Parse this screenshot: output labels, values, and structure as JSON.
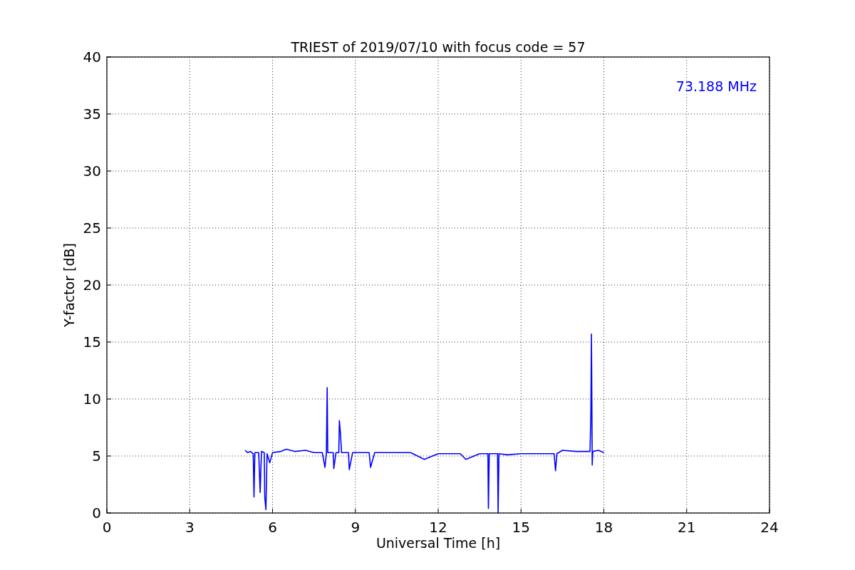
{
  "figure": {
    "chart_data": {
      "type": "line",
      "title": "TRIEST of 2019/07/10 with focus code = 57",
      "xlabel": "Universal Time [h]",
      "ylabel": "Y-factor [dB]",
      "xlim": [
        0,
        24
      ],
      "ylim": [
        0,
        40
      ],
      "xticks": [
        0,
        3,
        6,
        9,
        12,
        15,
        18,
        21,
        24
      ],
      "yticks": [
        0,
        5,
        10,
        15,
        20,
        25,
        30,
        35,
        40
      ],
      "x": [
        5.0,
        5.1,
        5.2,
        5.3,
        5.33,
        5.36,
        5.5,
        5.55,
        5.6,
        5.7,
        5.72,
        5.76,
        5.8,
        5.9,
        6.0,
        6.3,
        6.5,
        6.8,
        7.2,
        7.5,
        7.8,
        7.9,
        7.95,
        7.98,
        8.0,
        8.2,
        8.22,
        8.3,
        8.4,
        8.42,
        8.46,
        8.5,
        8.75,
        8.78,
        8.9,
        9.5,
        9.55,
        9.7,
        10.0,
        11.0,
        11.5,
        12.0,
        12.8,
        13.0,
        13.5,
        13.8,
        13.82,
        13.85,
        14.15,
        14.17,
        14.2,
        14.5,
        15.0,
        15.5,
        16.0,
        16.2,
        16.25,
        16.3,
        16.5,
        17.0,
        17.5,
        17.53,
        17.55,
        17.58,
        17.6,
        17.8,
        18.0
      ],
      "grid": true,
      "series": [
        {
          "color": "#0000ff",
          "values": [
            5.5,
            5.3,
            5.4,
            5.2,
            1.4,
            5.3,
            5.3,
            1.8,
            5.4,
            5.3,
            1.4,
            0.3,
            5.2,
            4.4,
            5.3,
            5.4,
            5.6,
            5.4,
            5.5,
            5.3,
            5.3,
            4.0,
            5.3,
            11.0,
            5.3,
            5.3,
            3.9,
            5.3,
            5.3,
            8.1,
            7.0,
            5.3,
            5.3,
            3.8,
            5.3,
            5.3,
            4.0,
            5.3,
            5.3,
            5.3,
            4.7,
            5.2,
            5.2,
            4.7,
            5.2,
            5.2,
            0.4,
            5.2,
            5.2,
            0.0,
            5.2,
            5.1,
            5.2,
            5.2,
            5.2,
            5.2,
            3.7,
            5.2,
            5.5,
            5.4,
            5.4,
            8.8,
            15.7,
            4.2,
            5.4,
            5.5,
            5.3
          ]
        }
      ],
      "annotations": [
        "73.188 MHz"
      ]
    }
  }
}
